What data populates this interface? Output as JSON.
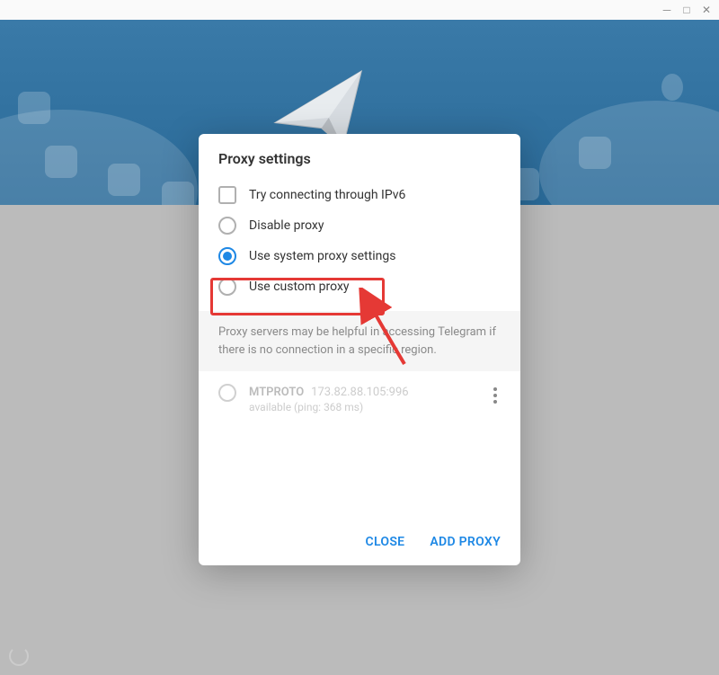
{
  "dialog": {
    "title": "Proxy settings",
    "options": {
      "ipv6": "Try connecting through IPv6",
      "disable": "Disable proxy",
      "system": "Use system proxy settings",
      "custom": "Use custom proxy"
    },
    "info": "Proxy servers may be helpful in accessing Telegram if there is no connection in a specific region.",
    "entry": {
      "name": "MTPROTO",
      "addr": "173.82.88.105:996",
      "status": "available (ping: 368 ms)"
    },
    "buttons": {
      "close": "CLOSE",
      "add": "ADD PROXY"
    }
  }
}
